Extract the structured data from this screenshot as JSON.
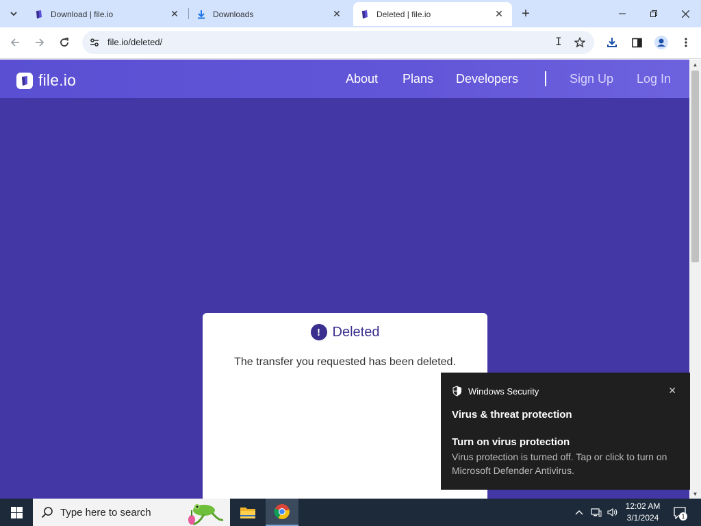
{
  "browser": {
    "tabs": [
      {
        "title": "Download | file.io",
        "icon": "fileio-favicon",
        "active": false
      },
      {
        "title": "Downloads",
        "icon": "download-icon",
        "active": false
      },
      {
        "title": "Deleted | file.io",
        "icon": "fileio-favicon",
        "active": true
      }
    ],
    "new_tab": "+",
    "url": "file.io/deleted/"
  },
  "site": {
    "brand": "file.io",
    "nav": {
      "about": "About",
      "plans": "Plans",
      "developers": "Developers",
      "signup": "Sign Up",
      "login": "Log In"
    },
    "card": {
      "icon_glyph": "!",
      "title": "Deleted",
      "message": "The transfer you requested has been deleted."
    },
    "colors": {
      "background": "#4337a5",
      "header": "#5a4fd2",
      "accent": "#3a2e8e"
    }
  },
  "toast": {
    "app": "Windows Security",
    "heading": "Virus & threat protection",
    "subheading": "Turn on virus protection",
    "body": "Virus protection is turned off. Tap or click to turn on Microsoft Defender Antivirus.",
    "close": "✕"
  },
  "taskbar": {
    "search_placeholder": "Type here to search",
    "time": "12:02 AM",
    "date": "3/1/2024",
    "notification_count": "1"
  }
}
